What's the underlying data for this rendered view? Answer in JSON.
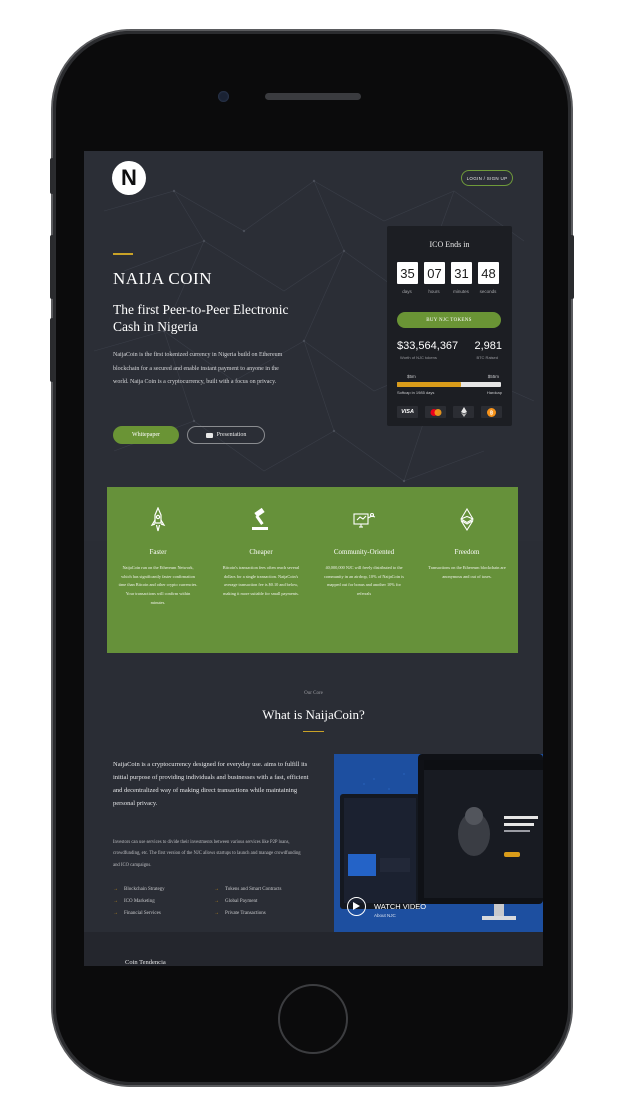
{
  "header": {
    "logo_letter": "N",
    "login_label": "LOGIN / SIGN UP"
  },
  "hero": {
    "brand": "NAIJA COIN",
    "tagline": "The first Peer-to-Peer Electronic Cash in Nigeria",
    "description": "NaijaCoin is the first tokenized currency in Nigeria build on Ethereum blockchain for a secured and enable instant payment to anyone in the world. Naija Coin is a cryptocurrency, built with a focus on privacy.",
    "whitepaper_label": "Whitepaper",
    "presentation_label": "Presentation"
  },
  "ico": {
    "title": "ICO Ends in",
    "countdown": [
      {
        "value": "35",
        "label": "days"
      },
      {
        "value": "07",
        "label": "hours"
      },
      {
        "value": "31",
        "label": "minutes"
      },
      {
        "value": "48",
        "label": "seconds"
      }
    ],
    "buy_label": "BUY NJC TOKENS",
    "amount": "$33,564,367",
    "amount_label": "Worth of NJC tokens",
    "btc": "2,981",
    "btc_label": "BTC Raised",
    "progress_left": "$5m",
    "progress_right": "$55m",
    "progress_fraction": 0.62,
    "softcap_label": "Softcap in 1985 days",
    "hardcap_label": "Hardcap",
    "payments": [
      "VISA",
      "mastercard-icon",
      "ethereum-icon",
      "bitcoin-icon"
    ],
    "payment_visa": "VISA"
  },
  "features": [
    {
      "icon": "rocket-icon",
      "title": "Faster",
      "text": "NaijaCoin run on the Ethereum Network, which has significantly faster confirmation time than Bitcoin and other crypto currencies. Your transactions will confirm within minutes."
    },
    {
      "icon": "gavel-icon",
      "title": "Cheaper",
      "text": "Bitcoin's transaction fees often reach several dollars for a single transaction. NaijaCoin's average transaction fee is $0.10 and below, making it more suitable for small payments."
    },
    {
      "icon": "community-icon",
      "title": "Community-Oriented",
      "text": "40,000,000 NJC will freely distributed to the community in an airdrop, 10% of NaijaCoin is mapped out for bonus and another 10% for referrals"
    },
    {
      "icon": "ethereum-icon",
      "title": "Freedom",
      "text": "Transactions on the Ethereum blockchain are anonymous and out of taxes."
    }
  ],
  "core": {
    "subtitle": "Our Core",
    "title": "What is NaijaCoin?",
    "paragraph1": "NaijaCoin is a cryptocurrency designed for everyday use. aims to fulfill its initial purpose of providing individuals and businesses with a fast, efficient and decentralized way of making direct transactions while maintaining personal privacy.",
    "paragraph2": "Investors can use services to divide their investments between various services like P2P loans, crowdfunding, etc. The first version of the NJC allows startups to launch and manage crowdfunding and ICO campaigns.",
    "list_left": [
      "Blockchain Strategy",
      "ICO Marketing",
      "Financial Services"
    ],
    "list_right": [
      "Tokens and Smart Contracts",
      "Global Payment",
      "Private Transactions"
    ]
  },
  "video": {
    "watch_label": "WATCH VIDEO",
    "about_label": "About NJC"
  },
  "footer": {
    "section_label": "Coin Tendencia"
  },
  "colors": {
    "accent_green": "#66913a",
    "accent_gold": "#c9a227",
    "bg_dark": "#2b2e36"
  }
}
